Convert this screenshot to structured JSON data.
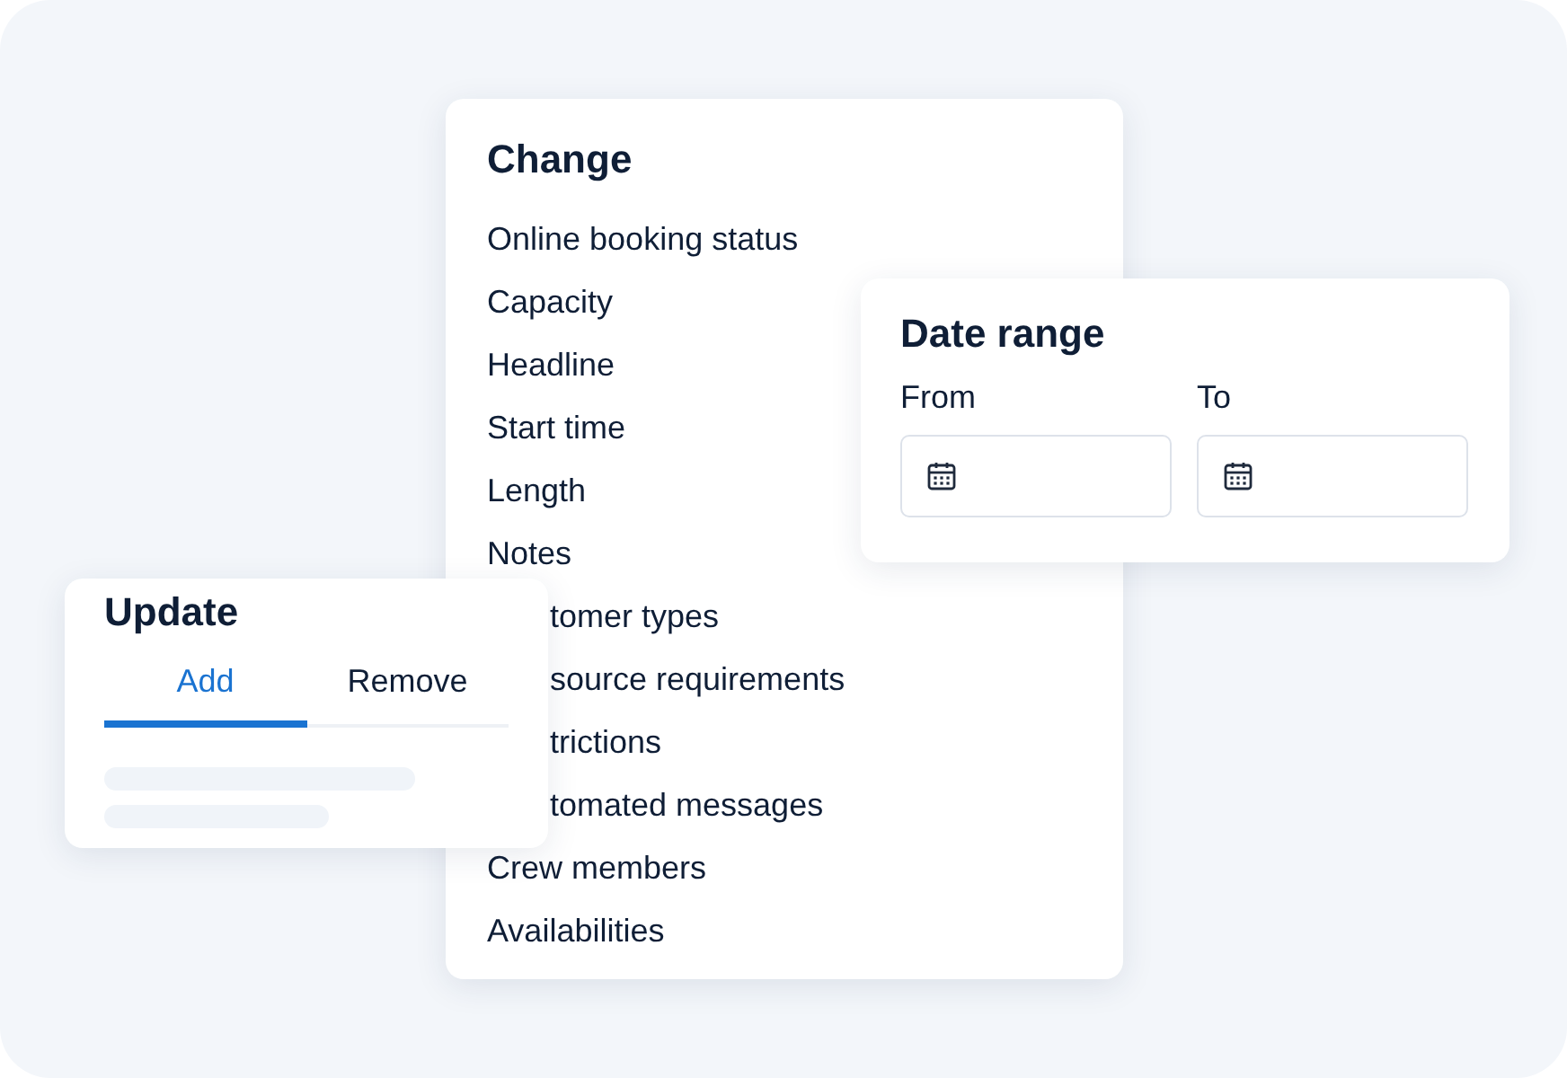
{
  "change": {
    "title": "Change",
    "items": [
      {
        "label": "Online booking status",
        "kind": "full"
      },
      {
        "label": "Capacity",
        "kind": "full"
      },
      {
        "label": "Headline",
        "kind": "full"
      },
      {
        "label": "Start time",
        "kind": "full"
      },
      {
        "label": "Length",
        "kind": "full"
      },
      {
        "label": "Notes",
        "kind": "full"
      },
      {
        "label": "tomer types",
        "kind": "partial"
      },
      {
        "label": "source requirements",
        "kind": "partial"
      },
      {
        "label": "trictions",
        "kind": "partial"
      },
      {
        "label": "tomated messages",
        "kind": "partial"
      },
      {
        "label": "Crew members",
        "kind": "full"
      },
      {
        "label": "Availabilities",
        "kind": "full"
      }
    ]
  },
  "date_range": {
    "title": "Date range",
    "fields": [
      {
        "label": "From"
      },
      {
        "label": "To"
      }
    ]
  },
  "update": {
    "title": "Update",
    "tabs": [
      {
        "label": "Add",
        "selected": true
      },
      {
        "label": "Remove",
        "selected": false
      }
    ]
  }
}
